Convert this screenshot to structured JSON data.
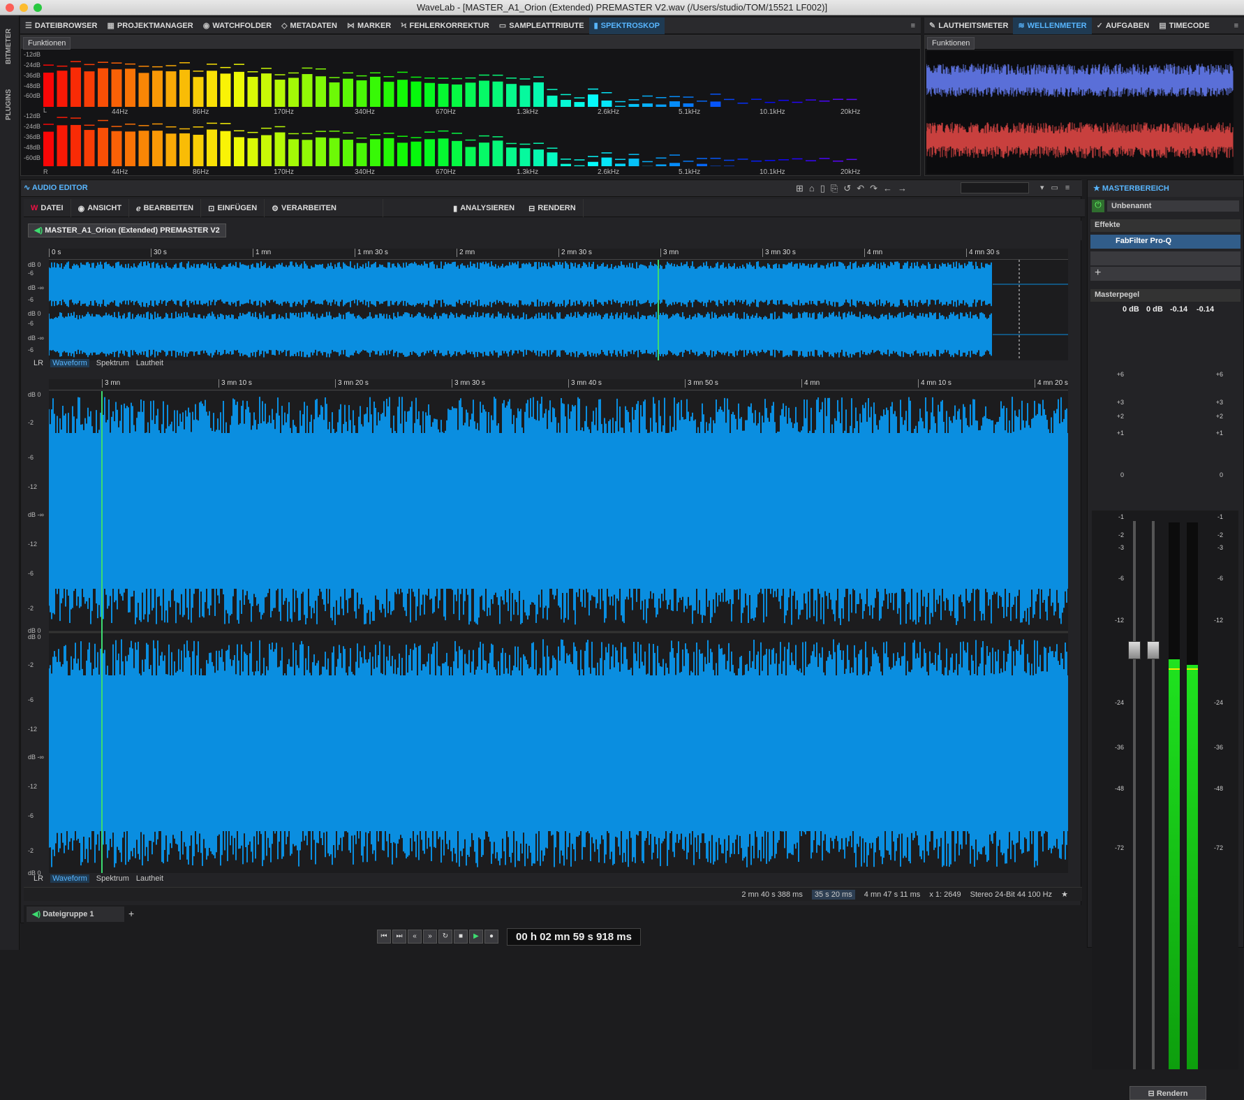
{
  "window": {
    "title": "WaveLab - [MASTER_A1_Orion (Extended) PREMASTER V2.wav (/Users/studio/TOM/15521 LF002)]"
  },
  "sidebar": {
    "items": [
      {
        "label": "BITMETER"
      },
      {
        "label": "PLUGINS"
      }
    ]
  },
  "top_tabs": [
    {
      "label": "DATEIBROWSER",
      "icon": "list-icon"
    },
    {
      "label": "PROJEKTMANAGER",
      "icon": "grid-icon"
    },
    {
      "label": "WATCHFOLDER",
      "icon": "watch-icon"
    },
    {
      "label": "METADATEN",
      "icon": "tag-icon"
    },
    {
      "label": "MARKER",
      "icon": "marker-icon"
    },
    {
      "label": "FEHLERKORREKTUR",
      "icon": "bolt-icon"
    },
    {
      "label": "SAMPLEATTRIBUTE",
      "icon": "sample-icon"
    },
    {
      "label": "SPEKTROSKOP",
      "icon": "bars-icon"
    }
  ],
  "right_tabs": [
    {
      "label": "LAUTHEITSMETER",
      "icon": "pencil-icon"
    },
    {
      "label": "WELLENMETER",
      "icon": "wave-icon"
    },
    {
      "label": "AUFGABEN",
      "icon": "check-icon"
    },
    {
      "label": "TIMECODE",
      "icon": "clock-icon"
    }
  ],
  "spectro": {
    "functions_label": "Funktionen",
    "db_labels": [
      "-12dB",
      "-24dB",
      "-36dB",
      "-48dB",
      "-60dB"
    ],
    "channel_left": "L",
    "channel_right": "R",
    "freq_labels": [
      "44Hz",
      "86Hz",
      "170Hz",
      "340Hz",
      "670Hz",
      "1.3kHz",
      "2.6kHz",
      "5.1kHz",
      "10.1kHz",
      "20kHz"
    ]
  },
  "wavemeter": {
    "functions_label": "Funktionen"
  },
  "audio_editor": {
    "title": "AUDIO EDITOR",
    "menu": [
      {
        "label": "DATEI",
        "icon": "wavelab-icon"
      },
      {
        "label": "ANSICHT",
        "icon": "eye-icon"
      },
      {
        "label": "BEARBEITEN",
        "icon": "edit-icon"
      },
      {
        "label": "EINFÜGEN",
        "icon": "insert-icon"
      },
      {
        "label": "VERARBEITEN",
        "icon": "process-icon"
      },
      {
        "label": "ANALYSIEREN",
        "icon": "analyze-icon"
      },
      {
        "label": "RENDERN",
        "icon": "render-icon"
      }
    ],
    "file_tab": "MASTER_A1_Orion (Extended) PREMASTER V2",
    "overview_ticks": [
      "0 s",
      "30 s",
      "1 mn",
      "1 mn 30 s",
      "2 mn",
      "2 mn 30 s",
      "3 mn",
      "3 mn 30 s",
      "4 mn",
      "4 mn 30 s"
    ],
    "main_ticks": [
      "3 mn",
      "3 mn 10 s",
      "3 mn 20 s",
      "3 mn 30 s",
      "3 mn 40 s",
      "3 mn 50 s",
      "4 mn",
      "4 mn 10 s",
      "4 mn 20 s"
    ],
    "overview_db": [
      "dB 0",
      "-6",
      "dB -∞",
      "-6",
      "dB 0",
      "-6",
      "dB -∞",
      "-6"
    ],
    "main_db_upper": [
      "dB 0",
      "-2",
      "-6",
      "-12",
      "dB -∞",
      "-12",
      "-6",
      "-2",
      "dB 0"
    ],
    "main_db_lower": [
      "dB 0",
      "-2",
      "-6",
      "-12",
      "dB -∞",
      "-12",
      "-6",
      "-2",
      "dB 0"
    ],
    "view_tabs": {
      "lr": "LR",
      "waveform": "Waveform",
      "spectrum": "Spektrum",
      "loudness": "Lautheit"
    },
    "status": {
      "cursor": "2 mn 40 s 388 ms",
      "selection": "35 s 20 ms",
      "length": "4 mn 47 s 11 ms",
      "zoom": "x 1: 2649",
      "format": "Stereo 24-Bit 44 100 Hz"
    },
    "file_group": "Dateigruppe 1",
    "add": "+"
  },
  "transport": {
    "time": "00 h 02 mn 59 s 918 ms"
  },
  "master": {
    "title": "MASTERBEREICH",
    "preset": "Unbenannt",
    "effects_label": "Effekte",
    "plugin_name": "FabFilter Pro-Q",
    "masterpegel": "Masterpegel",
    "gain_l": "0 dB",
    "gain_r": "0 dB",
    "peak_l": "-0.14",
    "peak_r": "-0.14",
    "scale": [
      "+6",
      "+3",
      "+2",
      "+1",
      "0",
      "-1",
      "-2",
      "-3",
      "-6",
      "-12",
      "-24",
      "-36",
      "-48",
      "-72"
    ],
    "render_label": "Rendern",
    "meter_level_l": 0.75,
    "meter_level_r": 0.74
  },
  "colors": {
    "accent": "#58b6ff",
    "wave": "#0a8ee0",
    "playhead": "#3ddc70",
    "meter": "#19d21c",
    "wm_left": "#5a6fd8",
    "wm_right": "#c8403f"
  }
}
